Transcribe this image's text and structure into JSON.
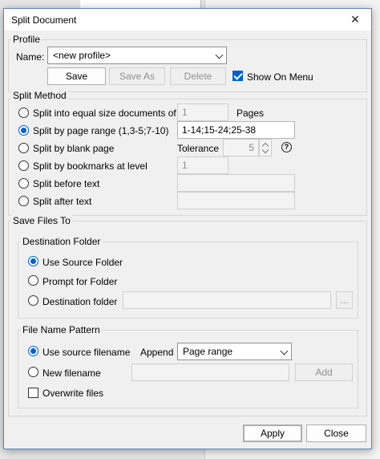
{
  "dialog": {
    "title": "Split Document",
    "close_glyph": "✕"
  },
  "profile": {
    "legend": "Profile",
    "name_label": "Name:",
    "name_value": "<new profile>",
    "save_label": "Save",
    "save_as_label": "Save As",
    "delete_label": "Delete",
    "show_on_menu_label": "Show On Menu",
    "show_on_menu_checked": true
  },
  "split_method": {
    "legend": "Split Method",
    "options": [
      {
        "label": "Split into equal size documents of",
        "selected": false,
        "value": "1",
        "suffix": "Pages"
      },
      {
        "label": "Split by page range (1,3-5;7-10)",
        "selected": true,
        "value": "1-14;15-24;25-38"
      },
      {
        "label": "Split by blank page",
        "selected": false,
        "tolerance_label": "Tolerance",
        "tolerance_value": "5"
      },
      {
        "label": "Split by bookmarks at level",
        "selected": false,
        "value": "1"
      },
      {
        "label": "Split before text",
        "selected": false,
        "value": ""
      },
      {
        "label": "Split after text",
        "selected": false,
        "value": ""
      }
    ],
    "help_glyph": "?"
  },
  "save_files": {
    "legend": "Save Files To",
    "destination": {
      "legend": "Destination Folder",
      "options": [
        {
          "label": "Use Source Folder",
          "selected": true
        },
        {
          "label": "Prompt for Folder",
          "selected": false
        },
        {
          "label": "Destination folder",
          "selected": false
        }
      ],
      "folder_value": "",
      "browse_label": "..."
    },
    "pattern": {
      "legend": "File Name Pattern",
      "use_source_label": "Use source filename",
      "use_source_selected": true,
      "append_label": "Append",
      "append_value": "Page range",
      "new_filename_label": "New filename",
      "new_filename_selected": false,
      "new_filename_value": "",
      "add_label": "Add",
      "overwrite_label": "Overwrite files",
      "overwrite_checked": false
    }
  },
  "footer": {
    "apply_label": "Apply",
    "close_label": "Close"
  }
}
